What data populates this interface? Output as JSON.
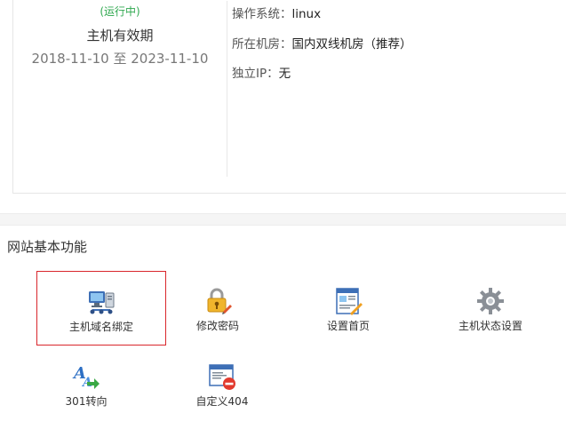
{
  "host_panel": {
    "status": "(运行中)",
    "validity_label": "主机有效期",
    "validity_range": "2018-11-10 至 2023-11-10",
    "info": [
      {
        "key": "操作系统：",
        "value": "linux"
      },
      {
        "key": "所在机房：",
        "value": "国内双线机房（推荐）"
      },
      {
        "key": "独立IP：",
        "value": "无"
      }
    ]
  },
  "section": {
    "title": "网站基本功能"
  },
  "functions": [
    {
      "label": "主机域名绑定",
      "icon": "computer-network-icon",
      "selected": true
    },
    {
      "label": "修改密码",
      "icon": "lock-pencil-icon",
      "selected": false
    },
    {
      "label": "设置首页",
      "icon": "page-edit-icon",
      "selected": false
    },
    {
      "label": "主机状态设置",
      "icon": "gear-icon",
      "selected": false
    },
    {
      "label": "301转向",
      "icon": "redirect-arrow-icon",
      "selected": false
    },
    {
      "label": "自定义404",
      "icon": "window-error-icon",
      "selected": false
    }
  ],
  "colors": {
    "status_green": "#2fa84f",
    "selected_border": "#d9262c"
  }
}
